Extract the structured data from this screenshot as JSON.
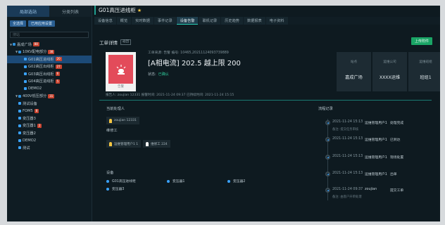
{
  "left_panel": {
    "tabs": [
      "局部选站",
      "分类列表"
    ],
    "buttons": [
      "全选择",
      "已用应用设置"
    ],
    "search_placeholder": "搜站",
    "tree": [
      {
        "label": "嘉成广场",
        "badge": "88",
        "level": 0,
        "expanded": true,
        "icon_color": "#2f8fd8"
      },
      {
        "label": "10KV配电部分",
        "badge": "38",
        "level": 1,
        "expanded": true,
        "icon_color": "#2f8fd8"
      },
      {
        "label": "G01高压进线柜",
        "badge": "20",
        "level": 2,
        "selected": true,
        "icon_color": "#3aa3ff"
      },
      {
        "label": "G02高压出线柜",
        "badge": "27",
        "level": 2,
        "icon_color": "#3aa3ff"
      },
      {
        "label": "G03高压出线柜",
        "badge": "6",
        "level": 2,
        "icon_color": "#3aa3ff"
      },
      {
        "label": "G04高压进线柜",
        "badge": "5",
        "level": 2,
        "icon_color": "#3aa3ff"
      },
      {
        "label": "DEMO2",
        "badge": "",
        "level": 2,
        "icon_color": "#3aa3ff"
      },
      {
        "label": "400V低压部分",
        "badge": "31",
        "level": 1,
        "expanded": true,
        "icon_color": "#2f8fd8"
      },
      {
        "label": "测试设备",
        "badge": "",
        "level": 1,
        "icon_color": "#3aa3ff"
      },
      {
        "label": "FOM5",
        "badge": "8",
        "level": 1,
        "icon_color": "#3aa3ff"
      },
      {
        "label": "变压器3",
        "badge": "",
        "level": 1,
        "icon_color": "#3aa3ff"
      },
      {
        "label": "变压器1",
        "badge": "2",
        "level": 1,
        "icon_color": "#3aa3ff"
      },
      {
        "label": "变压器2",
        "badge": "",
        "level": 1,
        "icon_color": "#3aa3ff"
      },
      {
        "label": "DEMO2",
        "badge": "",
        "level": 1,
        "icon_color": "#3aa3ff"
      },
      {
        "label": "测试",
        "badge": "",
        "level": 1,
        "icon_color": "#3aa3ff"
      }
    ]
  },
  "header": {
    "title": "G01高压进线柜",
    "star": "★",
    "tabs": [
      "设备信息",
      "概览",
      "实时数据",
      "事件记录",
      "设备告警",
      "联机记录",
      "历史趋势",
      "数据报表",
      "电子资料"
    ],
    "active_tab": 4
  },
  "work_order": {
    "section_title": "工单详情",
    "back_label": "返回",
    "upload_label": "上传附件",
    "alarm_caption": "告警",
    "meta": "工单来源: 告警  编号: 10465,20211124093739889",
    "title": "[A相电流] 202.5 越上限 200",
    "status_label": "状态:",
    "status_value": "已确认",
    "footer": "报告人: zoujian 12331    报警时间: 2021-11-24 09:37    已持续时间: 2021-11-24 15:15",
    "cards": [
      {
        "key": "站点",
        "value": "嘉成广场"
      },
      {
        "key": "运维公司",
        "value": "XXXX运维"
      },
      {
        "key": "运维班组",
        "value": "班组1"
      }
    ]
  },
  "handlers": {
    "current_label": "当前处理人",
    "current": [
      {
        "name": "zoujian 12331",
        "icon": "person-icon",
        "color": "#f4c542"
      }
    ],
    "maint_label": "维修工",
    "maint": [
      {
        "name": "运维管理用户1 1",
        "icon": "person-icon",
        "color": "#f4c542"
      },
      {
        "name": "维修工 224",
        "icon": "person-icon",
        "color": "#ffffff"
      }
    ]
  },
  "devices": {
    "label": "设备",
    "items": [
      "G01高压进线柜",
      "变压器1",
      "变压器2",
      "变压器3"
    ],
    "dot_color": "#3aa3ff"
  },
  "history": {
    "label": "流程记录",
    "events": [
      {
        "time": "2021-11-24 15:13",
        "user": "运维管理用户1",
        "action": "处理完成",
        "note": "备注: 提交任务审核"
      },
      {
        "time": "2021-11-24 15:13",
        "user": "运维管理用户1",
        "action": "已到达",
        "note": ""
      },
      {
        "time": "2021-11-24 15:13",
        "user": "运维管理用户1",
        "action": "现场处置",
        "note": ""
      },
      {
        "time": "2021-11-24 15:13",
        "user": "运维管理用户1",
        "action": "出单",
        "note": ""
      },
      {
        "time": "2021-11-24 09:37",
        "user": "zoujian",
        "action": "提交工单",
        "note": "备注: 由客户开单处理"
      }
    ]
  }
}
